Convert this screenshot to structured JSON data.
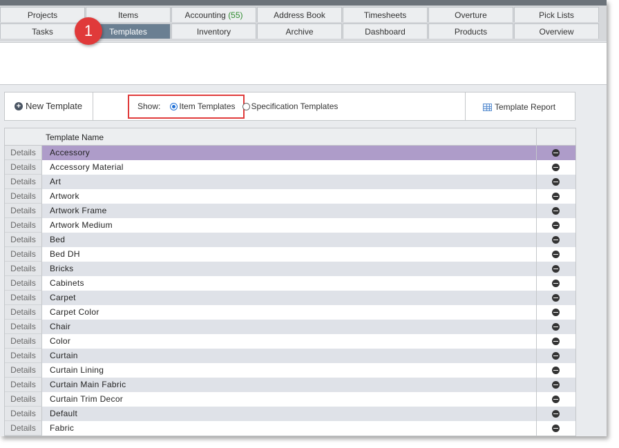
{
  "nav": {
    "row1": [
      {
        "label": "Projects"
      },
      {
        "label": "Items"
      },
      {
        "label": "Accounting",
        "count": "(55)"
      },
      {
        "label": "Address Book"
      },
      {
        "label": "Timesheets"
      },
      {
        "label": "Overture"
      },
      {
        "label": "Pick Lists"
      }
    ],
    "row2": [
      {
        "label": "Tasks"
      },
      {
        "label": "Templates"
      },
      {
        "label": "Inventory"
      },
      {
        "label": "Archive"
      },
      {
        "label": "Dashboard"
      },
      {
        "label": "Products"
      },
      {
        "label": "Overview"
      }
    ],
    "active_tab": "Templates"
  },
  "annotation": {
    "step": "1"
  },
  "toolbar": {
    "new_template": "New Template",
    "show_label": "Show:",
    "item_templates": "Item Templates",
    "spec_templates": "Specification Templates",
    "selected_show": "Item Templates",
    "template_report": "Template Report"
  },
  "grid": {
    "header": "Template Name",
    "details_label": "Details",
    "selected_row": "Accessory",
    "rows": [
      "Accessory",
      "Accessory Material",
      "Art",
      "Artwork",
      "Artwork Frame",
      "Artwork Medium",
      "Bed",
      "Bed DH",
      "Bricks",
      "Cabinets",
      "Carpet",
      "Carpet Color",
      "Chair",
      "Color",
      "Curtain",
      "Curtain Lining",
      "Curtain Main Fabric",
      "Curtain Trim Decor",
      "Default",
      "Fabric"
    ]
  },
  "colors": {
    "active_tab": "#6a7f92",
    "selected_row": "#ae9cc9",
    "alt_row": "#dfe2e8",
    "highlight": "#e03a3a",
    "count_green": "#2e8b2e"
  }
}
